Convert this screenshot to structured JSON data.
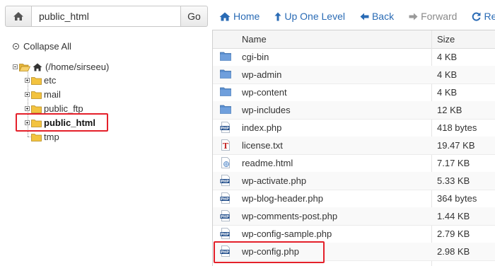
{
  "toolbar": {
    "path_value": "public_html",
    "go_label": "Go",
    "home_label": "Home",
    "up_label": "Up One Level",
    "back_label": "Back",
    "forward_label": "Forward",
    "reload_label": "Reload"
  },
  "tree": {
    "collapse_all": "Collapse All",
    "root": "(/home/sirseeu)",
    "children": [
      "etc",
      "mail",
      "public_ftp",
      "public_html",
      "tmp"
    ],
    "selected": "public_html"
  },
  "table": {
    "headers": {
      "name": "Name",
      "size": "Size"
    },
    "rows": [
      {
        "icon": "folder-icon",
        "name": "cgi-bin",
        "size": "4 KB"
      },
      {
        "icon": "folder-icon",
        "name": "wp-admin",
        "size": "4 KB"
      },
      {
        "icon": "folder-icon",
        "name": "wp-content",
        "size": "4 KB"
      },
      {
        "icon": "folder-icon",
        "name": "wp-includes",
        "size": "12 KB"
      },
      {
        "icon": "php-file-icon",
        "name": "index.php",
        "size": "418 bytes"
      },
      {
        "icon": "text-file-icon",
        "name": "license.txt",
        "size": "19.47 KB"
      },
      {
        "icon": "html-file-icon",
        "name": "readme.html",
        "size": "7.17 KB"
      },
      {
        "icon": "php-file-icon",
        "name": "wp-activate.php",
        "size": "5.33 KB"
      },
      {
        "icon": "php-file-icon",
        "name": "wp-blog-header.php",
        "size": "364 bytes"
      },
      {
        "icon": "php-file-icon",
        "name": "wp-comments-post.php",
        "size": "1.44 KB"
      },
      {
        "icon": "php-file-icon",
        "name": "wp-config-sample.php",
        "size": "2.79 KB"
      },
      {
        "icon": "php-file-icon",
        "name": "wp-config.php",
        "size": "2.98 KB"
      }
    ]
  },
  "colors": {
    "link": "#2a6bb5",
    "highlight": "#e4202a",
    "folder": "#f3c33f",
    "folder_blue": "#5b8fd0"
  }
}
